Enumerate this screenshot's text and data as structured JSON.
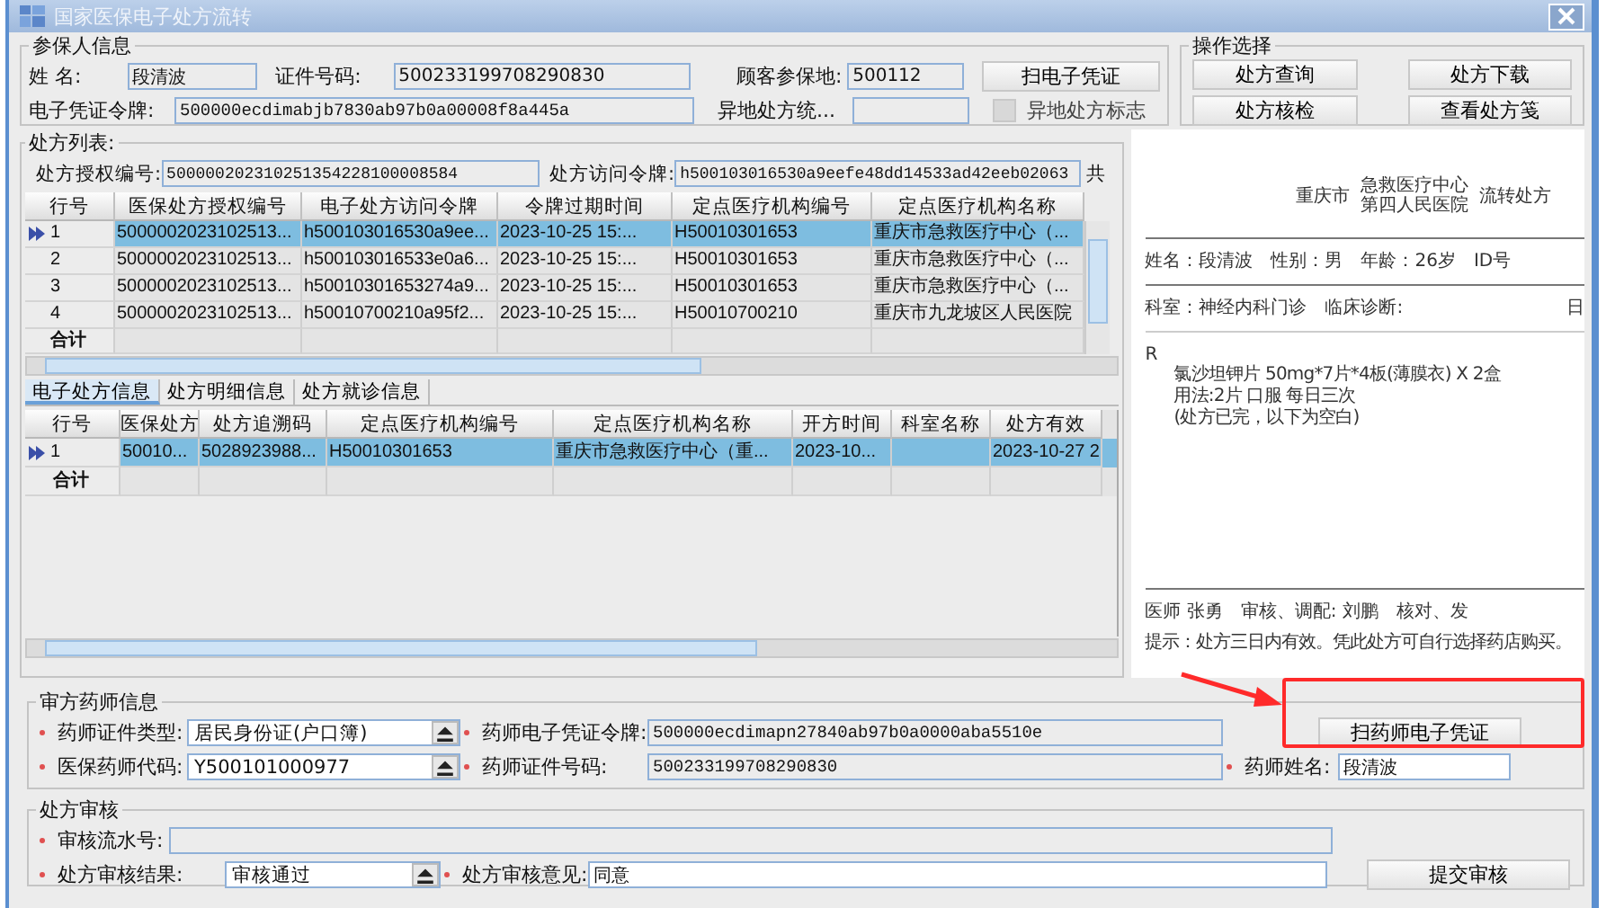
{
  "window": {
    "title": "国家医保电子处方流转"
  },
  "insured": {
    "title": "参保人信息",
    "name_label": "姓  名:",
    "name": "段清波",
    "id_label": "证件号码:",
    "id": "500233199708290830",
    "area_label": "顾客参保地:",
    "area": "500112",
    "scan_button": "扫电子凭证",
    "token_label": "电子凭证令牌:",
    "token": "500000ecdimabjb7830ab97b0a00008f8a445a",
    "remote_label": "异地处方统...",
    "remote_flag": {
      "label": "异地处方标志",
      "checked": false
    }
  },
  "operations": {
    "title": "操作选择",
    "buttons": [
      "处方查询",
      "处方下载",
      "处方核检",
      "查看处方笺"
    ]
  },
  "list": {
    "title": "处方列表:",
    "auth_label": "处方授权编号:",
    "auth": "500000202310251354228100008584",
    "access_label": "处方访问令牌:",
    "access": "h500103016530a9eefe48dd14533ad42eeb02063",
    "suffix": "共",
    "columns": [
      "行号",
      "医保处方授权编号",
      "电子处方访问令牌",
      "令牌过期时间",
      "定点医疗机构编号",
      "定点医疗机构名称"
    ],
    "rows": [
      {
        "selected": true,
        "cells": [
          "1",
          "5000002023102513...",
          "h500103016530a9ee...",
          "2023-10-25 15:...",
          "H50010301653",
          "重庆市急救医疗中心（..."
        ]
      },
      {
        "selected": false,
        "cells": [
          "2",
          "5000002023102513...",
          "h500103016533e0a6...",
          "2023-10-25 15:...",
          "H50010301653",
          "重庆市急救医疗中心（..."
        ]
      },
      {
        "selected": false,
        "cells": [
          "3",
          "5000002023102513...",
          "h50010301653274a9...",
          "2023-10-25 15:...",
          "H50010301653",
          "重庆市急救医疗中心（..."
        ]
      },
      {
        "selected": false,
        "cells": [
          "4",
          "5000002023102513...",
          "h50010700210a95f2...",
          "2023-10-25 15:...",
          "H50010700210",
          "重庆市九龙坡区人民医院"
        ]
      }
    ],
    "total_label": "合计"
  },
  "tabs": [
    {
      "label": "电子处方信息",
      "selected": true
    },
    {
      "label": "处方明细信息",
      "selected": false
    },
    {
      "label": "处方就诊信息",
      "selected": false
    }
  ],
  "detail": {
    "columns": [
      "行号",
      "医保处方",
      "处方追溯码",
      "定点医疗机构编号",
      "定点医疗机构名称",
      "开方时间",
      "科室名称",
      "处方有效"
    ],
    "rows": [
      {
        "selected": true,
        "cells": [
          "1",
          "50010...",
          "5028923988...",
          "H50010301653",
          "重庆市急救医疗中心（重...",
          "2023-10...",
          "",
          "2023-10-27 2"
        ]
      }
    ],
    "total_label": "合计"
  },
  "preview": {
    "city": "重庆市",
    "hospital": [
      "急救医疗中心",
      "第四人民医院"
    ],
    "title": "流转处方",
    "patient": [
      "姓名：段清波",
      "性别：男",
      "年龄：26岁",
      "ID号"
    ],
    "department": "科室：神经内科门诊",
    "diagnosis": "临床诊断:",
    "date": "日",
    "rx": "R",
    "items": [
      "氯沙坦钾片 50mg*7片*4板(薄膜衣) X 2盒",
      "用法:2片  口服  每日三次",
      "(处方已完，以下为空白)"
    ],
    "signatures": [
      "医师  张勇",
      "审核、调配: 刘鹏",
      "核对、发"
    ],
    "note": "提示：处方三日内有效。凭此处方可自行选择药店购买。"
  },
  "pharmacist": {
    "title": "审方药师信息",
    "cert_type_label": "药师证件类型:",
    "cert_type": "居民身份证(户口簿)",
    "token_label": "药师电子凭证令牌:",
    "token": "500000ecdimapn27840ab97b0a0000aba5510e",
    "scan_button": "扫药师电子凭证",
    "code_label": "医保药师代码:",
    "code": "Y500101000977",
    "cert_no_label": "药师证件号码:",
    "cert_no": "500233199708290830",
    "name_label": "药师姓名:",
    "name": "段清波"
  },
  "review": {
    "title": "处方审核",
    "serial_label": "审核流水号:",
    "result_label": "处方审核结果:",
    "result": "审核通过",
    "opinion_label": "处方审核意见:",
    "opinion": "同意",
    "submit_button": "提交审核"
  }
}
